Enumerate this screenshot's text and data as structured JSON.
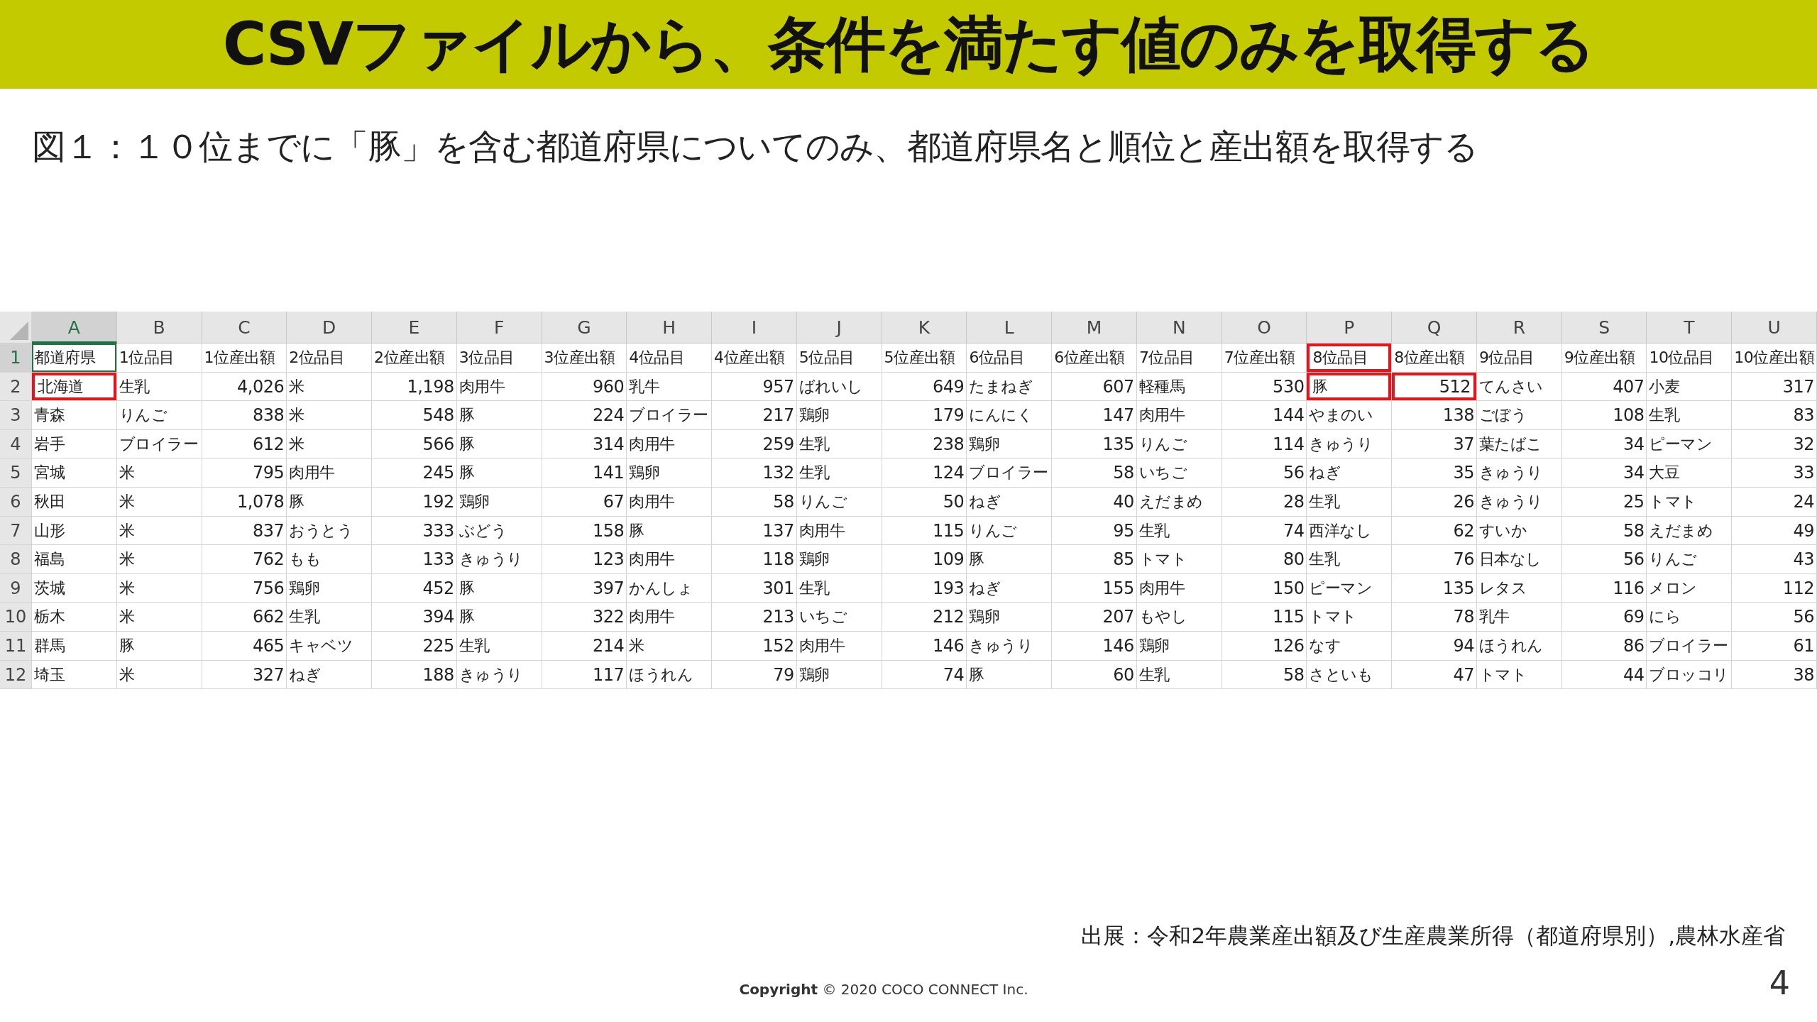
{
  "title": "CSVファイルから、条件を満たす値のみを取得する",
  "caption": "図１：１０位までに「豚」を含む都道府県についてのみ、都道府県名と順位と産出額を取得する",
  "sheet": {
    "columns": [
      {
        "letter": "A",
        "kind": "text",
        "selected": true
      },
      {
        "letter": "B",
        "kind": "text",
        "selected": false
      },
      {
        "letter": "C",
        "kind": "number",
        "selected": false
      },
      {
        "letter": "D",
        "kind": "text",
        "selected": false
      },
      {
        "letter": "E",
        "kind": "number",
        "selected": false
      },
      {
        "letter": "F",
        "kind": "text",
        "selected": false
      },
      {
        "letter": "G",
        "kind": "number",
        "selected": false
      },
      {
        "letter": "H",
        "kind": "text",
        "selected": false
      },
      {
        "letter": "I",
        "kind": "number",
        "selected": false
      },
      {
        "letter": "J",
        "kind": "text",
        "selected": false
      },
      {
        "letter": "K",
        "kind": "number",
        "selected": false
      },
      {
        "letter": "L",
        "kind": "text",
        "selected": false
      },
      {
        "letter": "M",
        "kind": "number",
        "selected": false
      },
      {
        "letter": "N",
        "kind": "text",
        "selected": false
      },
      {
        "letter": "O",
        "kind": "number",
        "selected": false
      },
      {
        "letter": "P",
        "kind": "text",
        "selected": false
      },
      {
        "letter": "Q",
        "kind": "number",
        "selected": false
      },
      {
        "letter": "R",
        "kind": "text",
        "selected": false
      },
      {
        "letter": "S",
        "kind": "number",
        "selected": false
      },
      {
        "letter": "T",
        "kind": "text",
        "selected": false
      },
      {
        "letter": "U",
        "kind": "number",
        "selected": false
      }
    ],
    "rows": [
      {
        "number": "1",
        "selected": true,
        "cells": [
          "都道府県",
          "1位品目",
          "1位産出額",
          "2位品目",
          "2位産出額",
          "3位品目",
          "3位産出額",
          "4位品目",
          "4位産出額",
          "5位品目",
          "5位産出額",
          "6位品目",
          "6位産出額",
          "7位品目",
          "7位産出額",
          {
            "text": "8位品目",
            "highlighted": true
          },
          "8位産出額",
          "9位品目",
          "9位産出額",
          "10位品目",
          "10位産出額"
        ]
      },
      {
        "number": "2",
        "selected": false,
        "cells": [
          {
            "text": "北海道",
            "highlighted": true
          },
          "生乳",
          "4,026",
          "米",
          "1,198",
          "肉用牛",
          "960",
          "乳牛",
          "957",
          "ばれいし",
          "649",
          "たまねぎ",
          "607",
          "軽種馬",
          "530",
          {
            "text": "豚",
            "highlighted": true
          },
          {
            "text": "512",
            "highlighted": true
          },
          "てんさい",
          "407",
          "小麦",
          "317"
        ]
      },
      {
        "number": "3",
        "selected": false,
        "cells": [
          "青森",
          "りんご",
          "838",
          "米",
          "548",
          "豚",
          "224",
          "ブロイラー",
          "217",
          "鶏卵",
          "179",
          "にんにく",
          "147",
          "肉用牛",
          "144",
          "やまのい",
          "138",
          "ごぼう",
          "108",
          "生乳",
          "83"
        ]
      },
      {
        "number": "4",
        "selected": false,
        "cells": [
          "岩手",
          "ブロイラー",
          "612",
          "米",
          "566",
          "豚",
          "314",
          "肉用牛",
          "259",
          "生乳",
          "238",
          "鶏卵",
          "135",
          "りんご",
          "114",
          "きゅうり",
          "37",
          "葉たばこ",
          "34",
          "ピーマン",
          "32"
        ]
      },
      {
        "number": "5",
        "selected": false,
        "cells": [
          "宮城",
          "米",
          "795",
          "肉用牛",
          "245",
          "豚",
          "141",
          "鶏卵",
          "132",
          "生乳",
          "124",
          "ブロイラー",
          "58",
          "いちご",
          "56",
          "ねぎ",
          "35",
          "きゅうり",
          "34",
          "大豆",
          "33"
        ]
      },
      {
        "number": "6",
        "selected": false,
        "cells": [
          "秋田",
          "米",
          "1,078",
          "豚",
          "192",
          "鶏卵",
          "67",
          "肉用牛",
          "58",
          "りんご",
          "50",
          "ねぎ",
          "40",
          "えだまめ",
          "28",
          "生乳",
          "26",
          "きゅうり",
          "25",
          "トマト",
          "24"
        ]
      },
      {
        "number": "7",
        "selected": false,
        "cells": [
          "山形",
          "米",
          "837",
          "おうとう",
          "333",
          "ぶどう",
          "158",
          "豚",
          "137",
          "肉用牛",
          "115",
          "りんご",
          "95",
          "生乳",
          "74",
          "西洋なし",
          "62",
          "すいか",
          "58",
          "えだまめ",
          "49"
        ]
      },
      {
        "number": "8",
        "selected": false,
        "cells": [
          "福島",
          "米",
          "762",
          "もも",
          "133",
          "きゅうり",
          "123",
          "肉用牛",
          "118",
          "鶏卵",
          "109",
          "豚",
          "85",
          "トマト",
          "80",
          "生乳",
          "76",
          "日本なし",
          "56",
          "りんご",
          "43"
        ]
      },
      {
        "number": "9",
        "selected": false,
        "cells": [
          "茨城",
          "米",
          "756",
          "鶏卵",
          "452",
          "豚",
          "397",
          "かんしょ",
          "301",
          "生乳",
          "193",
          "ねぎ",
          "155",
          "肉用牛",
          "150",
          "ピーマン",
          "135",
          "レタス",
          "116",
          "メロン",
          "112"
        ]
      },
      {
        "number": "10",
        "selected": false,
        "cells": [
          "栃木",
          "米",
          "662",
          "生乳",
          "394",
          "豚",
          "322",
          "肉用牛",
          "213",
          "いちご",
          "212",
          "鶏卵",
          "207",
          "もやし",
          "115",
          "トマト",
          "78",
          "乳牛",
          "69",
          "にら",
          "56"
        ]
      },
      {
        "number": "11",
        "selected": false,
        "cells": [
          "群馬",
          "豚",
          "465",
          "キャベツ",
          "225",
          "生乳",
          "214",
          "米",
          "152",
          "肉用牛",
          "146",
          "きゅうり",
          "146",
          "鶏卵",
          "126",
          "なす",
          "94",
          "ほうれん",
          "86",
          "ブロイラー",
          "61"
        ]
      },
      {
        "number": "12",
        "selected": false,
        "cells": [
          "埼玉",
          "米",
          "327",
          "ねぎ",
          "188",
          "きゅうり",
          "117",
          "ほうれん",
          "79",
          "鶏卵",
          "74",
          "豚",
          "60",
          "生乳",
          "58",
          "さといも",
          "47",
          "トマト",
          "44",
          "ブロッコリ",
          "38"
        ]
      }
    ]
  },
  "source": "出展：令和2年農業産出額及び生産農業所得（都道府県別）,農林水産省",
  "copyright": {
    "label": "Copyright",
    "text": "© 2020 COCO CONNECT Inc."
  },
  "page_number": "4"
}
